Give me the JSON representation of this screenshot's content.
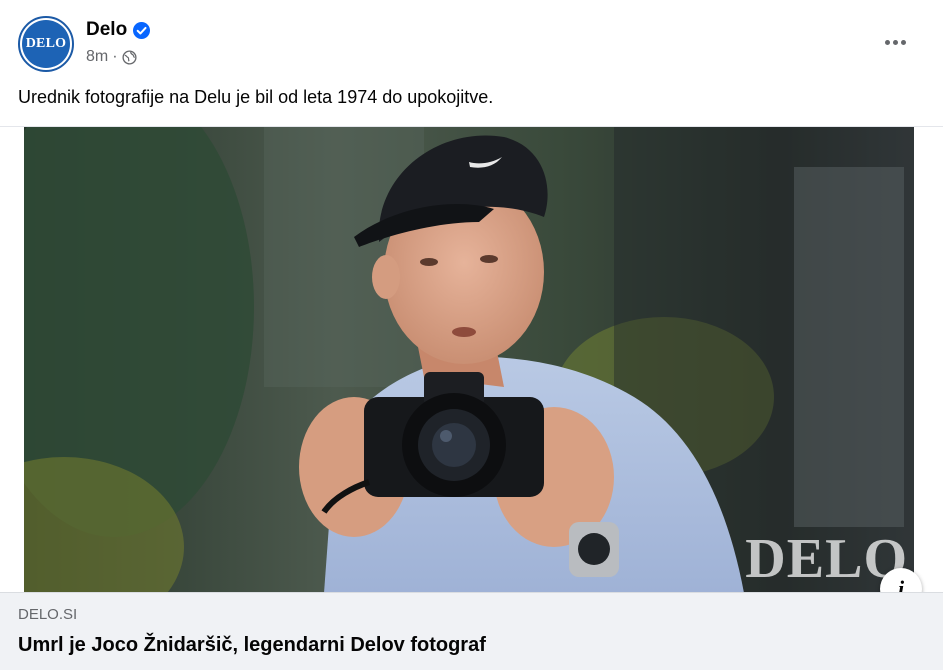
{
  "post": {
    "author": "Delo",
    "avatar_text": "DELO",
    "verified_icon": "verified-badge-icon",
    "time": "8m",
    "separator": "·",
    "privacy_icon": "globe-icon",
    "more_icon": "more-options-icon",
    "text": "Urednik fotografije na Delu je bil od leta 1974 do upokojitve."
  },
  "media": {
    "watermark": "DELO",
    "info_icon_glyph": "i"
  },
  "link": {
    "domain": "DELO.SI",
    "title": "Umrl je Joco Žnidaršič, legendarni Delov fotograf"
  },
  "colors": {
    "brand_blue": "#1d63b5",
    "verified_blue": "#0866ff",
    "secondary_text": "#65676b",
    "preview_bg": "#f0f2f5"
  }
}
